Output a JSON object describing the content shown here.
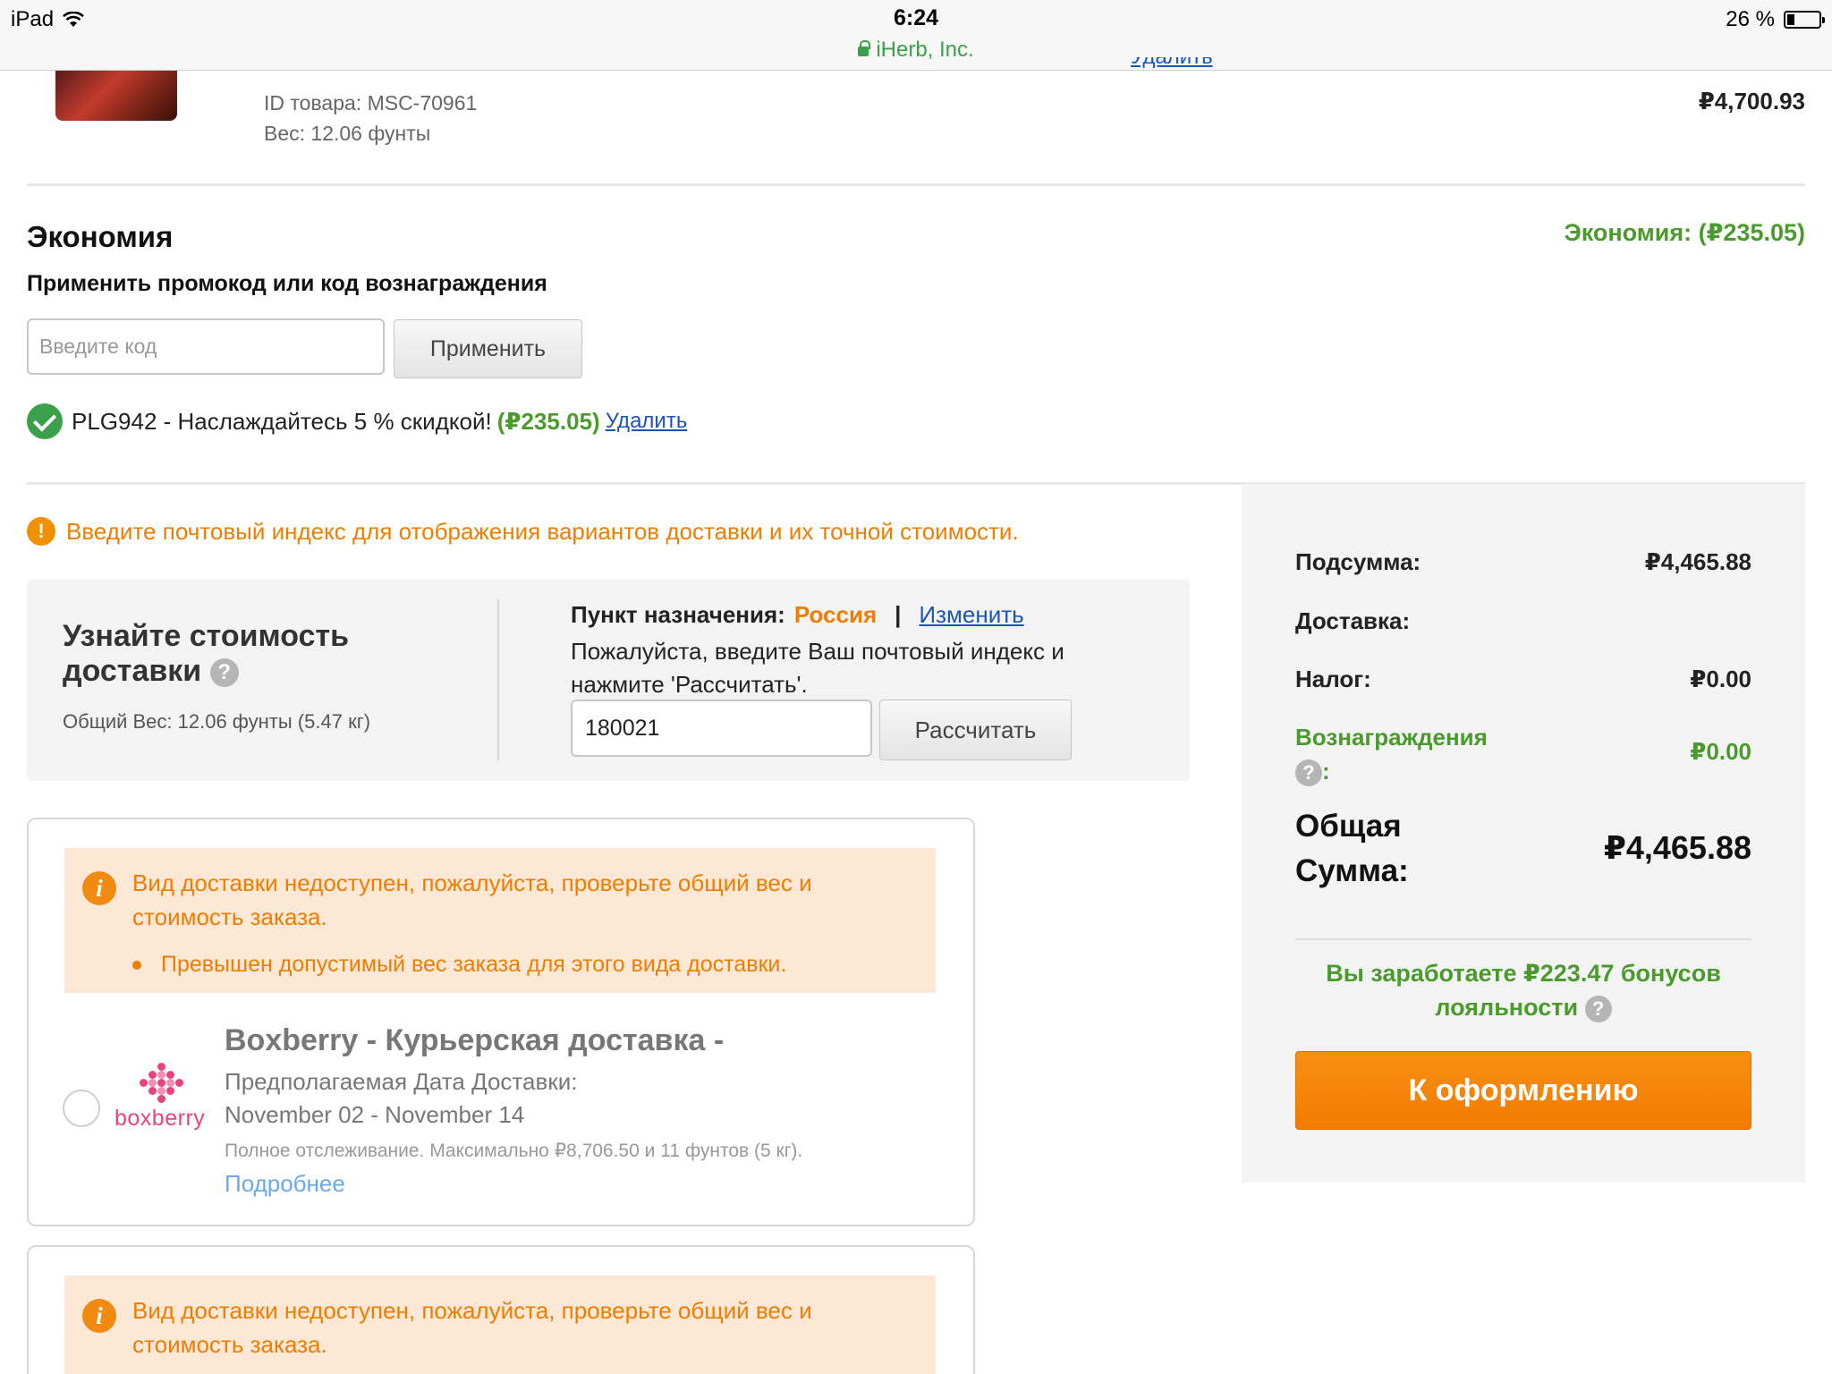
{
  "status_bar": {
    "device": "iPad",
    "time": "6:24",
    "site": "iHerb, Inc.",
    "battery": "26 %"
  },
  "product": {
    "id_text": "ID товара: MSC-70961",
    "weight_text": "Вес: 12.06 фунты",
    "price": "₽4,700.93"
  },
  "savings": {
    "title": "Экономия",
    "total_label": "Экономия:",
    "total_value": "(₽235.05)",
    "promo_label": "Применить промокод или код вознаграждения",
    "code_placeholder": "Введите код",
    "apply_label": "Применить",
    "applied_code_text": "PLG942 - Наслаждайтесь 5 % скидкой!",
    "applied_amount": "(₽235.05)",
    "remove_label": "Удалить"
  },
  "zip_warning": "Введите почтовый индекс для отображения вариантов доставки и их точной стоимости.",
  "shipping_calc": {
    "title": "Узнайте стоимость доставки",
    "total_weight": "Общий Вес: 12.06 фунты (5.47 кг)",
    "destination_label": "Пункт назначения:",
    "country": "Россия",
    "separator": "|",
    "change_label": "Изменить",
    "instructions": "Пожалуйста, введите Ваш почтовый индекс и нажмите 'Рассчитать'.",
    "zip_value": "180021",
    "calc_label": "Рассчитать"
  },
  "shipping_options": [
    {
      "alert": "Вид доставки недоступен, пожалуйста, проверьте общий вес и стоимость заказа.",
      "alert_bullet": "Превышен допустимый вес заказа для этого вида доставки.",
      "logo_text": "boxberry",
      "title": "Boxberry - Курьерская доставка -",
      "eta_label": "Предполагаемая Дата Доставки:",
      "eta": "November 02 - November 14",
      "tracking": "Полное отслеживание. Максимально ₽8,706.50 и 11 фунтов (5 кг).",
      "more_label": "Подробнее"
    },
    {
      "alert": "Вид доставки недоступен, пожалуйста, проверьте общий вес и стоимость заказа."
    }
  ],
  "summary": {
    "subtotal_label": "Подсумма:",
    "subtotal_value": "₽4,465.88",
    "shipping_label": "Доставка:",
    "tax_label": "Налог:",
    "tax_value": "₽0.00",
    "rewards_label": "Вознаграждения",
    "rewards_colon": ":",
    "rewards_value": "₽0.00",
    "total_label_1": "Общая",
    "total_label_2": "Сумма:",
    "total_value": "₽4,465.88",
    "loyalty_text": "Вы заработаете ₽223.47 бонусов лояльности",
    "checkout_label": "К оформлению"
  },
  "colors": {
    "accent_orange": "#f17c00",
    "savings_green": "#4a9a2c",
    "link_blue": "#1a56b8"
  }
}
